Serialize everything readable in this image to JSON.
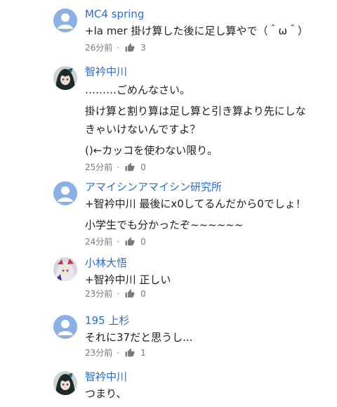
{
  "comments": [
    {
      "author": "MC4 spring",
      "avatar": "default-user-icon",
      "lines": [
        "+la mer 掛け算した後に足し算やで（＾ω＾）"
      ],
      "time": "26分前",
      "likes": "3"
    },
    {
      "author": "智衿中川",
      "avatar": "anime-avatar",
      "lines": [
        "………ごめんなさい。",
        "掛け算と割り算は足し算と引き算より先にしな",
        "きゃいけないんですよ？",
        "()←カッコを使わない限り。"
      ],
      "time": "25分前",
      "likes": "0"
    },
    {
      "author": "アマイシンアマイシン研究所",
      "avatar": "default-user-icon",
      "lines": [
        "+智衿中川 最後にx0してるんだから0でしょ！",
        "小学生でも分かったぞ~~~~~~"
      ],
      "time": "24分前",
      "likes": "0"
    },
    {
      "author": "小林大悟",
      "avatar": "anime-avatar",
      "lines": [
        "+智衿中川 正しい"
      ],
      "time": "23分前",
      "likes": "0"
    },
    {
      "author": "195 上杉",
      "avatar": "default-user-icon",
      "lines": [
        "それに37だと思うし..."
      ],
      "time": "23分前",
      "likes": "1"
    },
    {
      "author": "智衿中川",
      "avatar": "anime-avatar",
      "lines": [
        "つまり、"
      ],
      "time": "",
      "likes": ""
    }
  ],
  "colors": {
    "author": "#2b6bd6",
    "text": "#212121",
    "meta": "#7a7a7a",
    "avatar_bg": "#8ab0e5"
  }
}
